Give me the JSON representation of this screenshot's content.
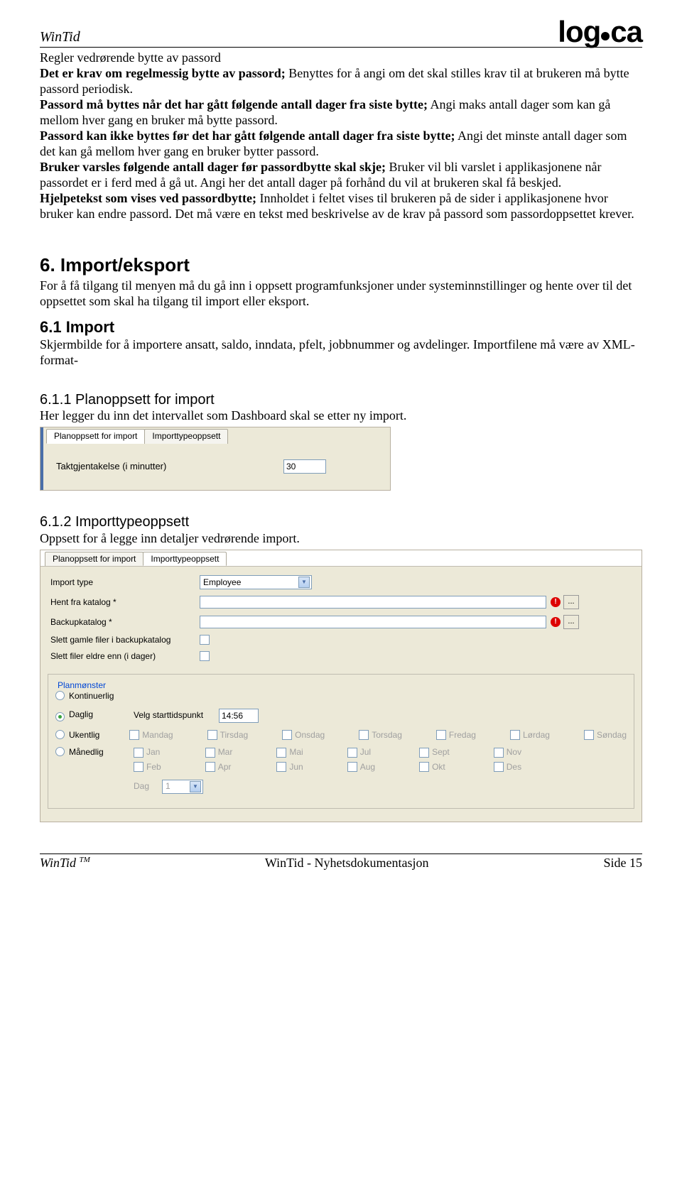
{
  "header": {
    "product": "WinTid",
    "logo": "logica"
  },
  "section_title": "Regler vedrørende bytte av passord",
  "paras": [
    {
      "bold": "Det er krav om regelmessig bytte av passord;",
      "rest": " Benyttes for å angi om det skal stilles krav til at brukeren må bytte passord periodisk."
    },
    {
      "bold": "Passord må byttes når det har gått følgende antall dager fra siste bytte;",
      "rest": " Angi maks antall dager som kan gå mellom hver gang en bruker må bytte passord."
    },
    {
      "bold": "Passord kan ikke byttes før det har gått følgende antall dager fra siste bytte;",
      "rest": " Angi det minste antall dager som det kan gå mellom hver gang en bruker bytter passord."
    },
    {
      "bold": "Bruker varsles følgende antall dager før passordbytte skal skje;",
      "rest": " Bruker vil bli varslet i applikasjonene når passordet er i ferd med å gå ut. Angi her det antall dager på forhånd du vil at brukeren skal få beskjed."
    },
    {
      "bold": "Hjelpetekst som vises ved passordbytte;",
      "rest": " Innholdet i feltet vises til brukeren på de sider i applikasjonene hvor bruker kan endre passord. Det må være en tekst med beskrivelse av de krav på passord som passordoppsettet krever."
    }
  ],
  "s6": {
    "title": "6. Import/eksport",
    "intro": "For å få tilgang til menyen må du gå inn i oppsett programfunksjoner under systeminnstillinger og hente over til det oppsettet som skal ha tilgang til import eller eksport."
  },
  "s61": {
    "title": "6.1  Import",
    "text": "Skjermbilde for å importere ansatt, saldo, inndata, pfelt, jobbnummer og avdelinger. Importfilene må være av XML-format-"
  },
  "s611": {
    "title": "6.1.1  Planoppsett for import",
    "text": "Her legger du inn det intervallet som Dashboard skal se etter ny import."
  },
  "img1": {
    "tab1": "Planoppsett for import",
    "tab2": "Importtypeoppsett",
    "label": "Taktgjentakelse (i minutter)",
    "value": "30"
  },
  "s612": {
    "title": "6.1.2  Importtypeoppsett",
    "text": "Oppsett for å legge inn detaljer vedrørende import."
  },
  "img2": {
    "tab1": "Planoppsett for import",
    "tab2": "Importtypeoppsett",
    "lbl_import_type": "Import type",
    "val_import_type": "Employee",
    "lbl_hent": "Hent fra katalog *",
    "lbl_backup": "Backupkatalog *",
    "lbl_slett": "Slett gamle filer i backupkatalog",
    "lbl_slett_dager": "Slett filer eldre enn (i dager)",
    "legend": "Planmønster",
    "r1": "Kontinuerlig",
    "r2": "Daglig",
    "r3": "Ukentlig",
    "r4": "Månedlig",
    "velg": "Velg starttidspunkt",
    "time": "14:56",
    "days": [
      "Mandag",
      "Tirsdag",
      "Onsdag",
      "Torsdag",
      "Fredag",
      "Lørdag",
      "Søndag"
    ],
    "months_col1": [
      "Jan",
      "Feb"
    ],
    "months_col2": [
      "Mar",
      "Apr"
    ],
    "months_col3": [
      "Mai",
      "Jun"
    ],
    "months_col4": [
      "Jul",
      "Aug"
    ],
    "months_col5": [
      "Sept",
      "Okt"
    ],
    "months_col6": [
      "Nov",
      "Des"
    ],
    "dag_label": "Dag",
    "dag_val": "1"
  },
  "footer": {
    "left": "WinTid",
    "tm": "TM",
    "center": "WinTid - Nyhetsdokumentasjon",
    "right": "Side 15"
  }
}
